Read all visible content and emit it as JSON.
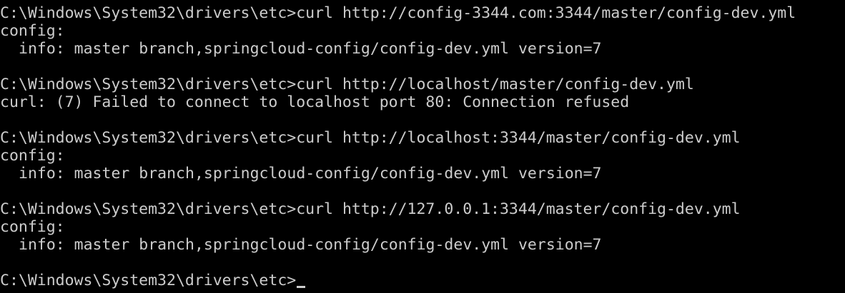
{
  "terminal": {
    "prompt": "C:\\Windows\\System32\\drivers\\etc>",
    "colors": {
      "background": "#000000",
      "foreground": "#cccccc"
    },
    "blocks": [
      {
        "command": "curl http://config-3344.com:3344/master/config-dev.yml",
        "output": [
          "config:",
          "info: master branch,springcloud-config/config-dev.yml version=7"
        ]
      },
      {
        "command": "curl http://localhost/master/config-dev.yml",
        "output": [
          "curl: (7) Failed to connect to localhost port 80: Connection refused"
        ]
      },
      {
        "command": "curl http://localhost:3344/master/config-dev.yml",
        "output": [
          "config:",
          "info: master branch,springcloud-config/config-dev.yml version=7"
        ]
      },
      {
        "command": "curl http://127.0.0.1:3344/master/config-dev.yml",
        "output": [
          "config:",
          "info: master branch,springcloud-config/config-dev.yml version=7"
        ]
      }
    ]
  }
}
